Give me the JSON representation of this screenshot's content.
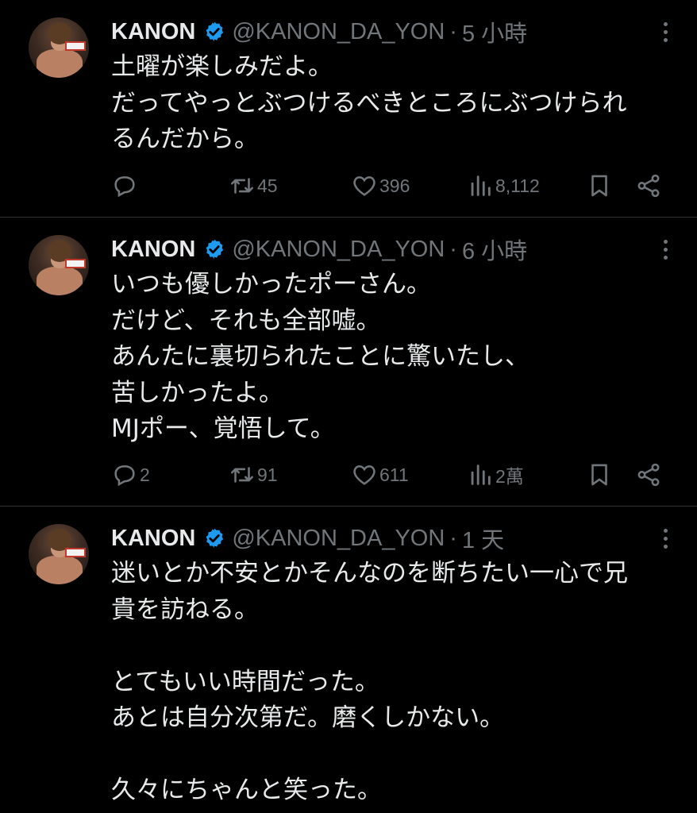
{
  "tweets": [
    {
      "name": "KANON",
      "handle": "@KANON_DA_YON",
      "separator": "·",
      "time": "5 小時",
      "lines": [
        "土曜が楽しみだよ。",
        "だってやっとぶつけるべきところにぶつけられ",
        "るんだから。"
      ],
      "replies": "",
      "retweets": "45",
      "likes": "396",
      "views": "8,112"
    },
    {
      "name": "KANON",
      "handle": "@KANON_DA_YON",
      "separator": "·",
      "time": "6 小時",
      "lines": [
        "いつも優しかったポーさん。",
        "だけど、それも全部嘘。",
        "あんたに裏切られたことに驚いたし、",
        "苦しかったよ。",
        "MJポー、覚悟して。"
      ],
      "replies": "2",
      "retweets": "91",
      "likes": "611",
      "views": "2萬"
    },
    {
      "name": "KANON",
      "handle": "@KANON_DA_YON",
      "separator": "·",
      "time": "1 天",
      "lines": [
        "迷いとか不安とかそんなのを断ちたい一心で兄",
        "貴を訪ねる。",
        "",
        "とてもいい時間だった。",
        "あとは自分次第だ。磨くしかない。",
        "",
        "久々にちゃんと笑った。"
      ],
      "replies": "",
      "retweets": "",
      "likes": "",
      "views": ""
    }
  ],
  "colors": {
    "background": "#000000",
    "text": "#e7e9ea",
    "muted": "#71767b",
    "verified": "#1d9bf0",
    "divider": "#2f3336"
  },
  "icons": [
    "reply-icon",
    "retweet-icon",
    "like-icon",
    "views-icon",
    "bookmark-icon",
    "share-icon",
    "verified-badge-icon",
    "more-icon"
  ]
}
